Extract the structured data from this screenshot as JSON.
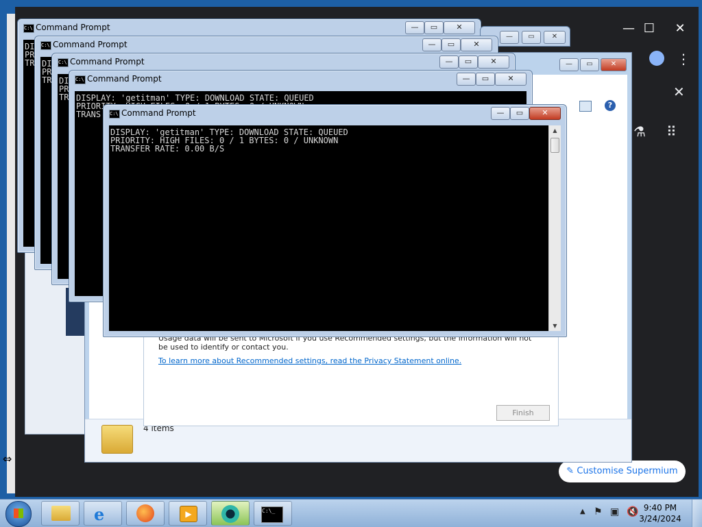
{
  "cmd_windows": [
    {
      "title": "Command Prompt",
      "lines": [
        "DI",
        "PR",
        "TR"
      ]
    },
    {
      "title": "Command Prompt",
      "lines": [
        "DI",
        "PR",
        "TR"
      ]
    },
    {
      "title": "Command Prompt",
      "lines": [
        "DI",
        "PR",
        "TR"
      ]
    },
    {
      "title": "Command Prompt",
      "lines": [
        "DISPLAY: 'getitman' TYPE: DOWNLOAD STATE: QUEUED",
        "PRIORITY: HIGH FILES: 0 / 1 BYTES: 0 / UNKNOWN",
        "TRANS"
      ]
    },
    {
      "title": "Command Prompt",
      "lines": [
        "DISPLAY: 'getitman' TYPE: DOWNLOAD STATE: QUEUED",
        "PRIORITY: HIGH FILES: 0 / 1 BYTES: 0 / UNKNOWN",
        "TRANSFER RATE: 0.00 B/S"
      ]
    }
  ],
  "explorer": {
    "status_text": "4 items"
  },
  "wizard": {
    "usage_text": "Usage data will be sent to Microsoft if you use Recommended settings, but the information will not be used to identify or contact you.",
    "privacy_link": "To learn more about Recommended settings, read the Privacy Statement online.",
    "finish_label": "Finish"
  },
  "browser": {
    "customise_label": "Customise Supermium",
    "icons": [
      "profile-icon",
      "more-icon",
      "close-icon",
      "labs-icon",
      "apps-icon"
    ]
  },
  "taskbar": {
    "time": "9:40 PM",
    "date": "3/24/2024",
    "items": [
      "start-orb",
      "windows-explorer",
      "internet-explorer",
      "firefox",
      "media-player",
      "browser",
      "command-prompt"
    ]
  },
  "colors": {
    "desktop": "#1d5fa5",
    "console_bg": "#000000",
    "console_text": "#d8d8d8",
    "link": "#0066cc",
    "accent_blue": "#1a73e8"
  }
}
